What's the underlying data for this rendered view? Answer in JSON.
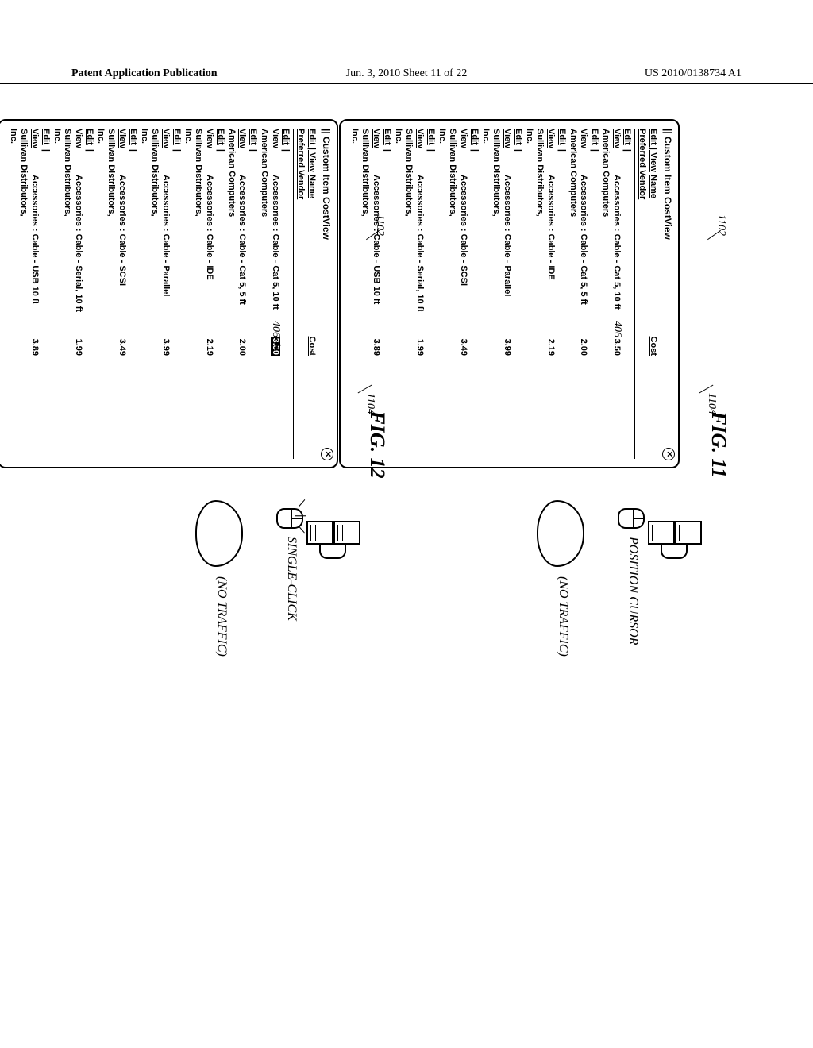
{
  "header": {
    "left": "Patent Application Publication",
    "mid": "Jun. 3, 2010  Sheet 11 of 22",
    "right": "US 2010/0138734 A1"
  },
  "figures": [
    {
      "id": "fig11",
      "number": "FIG. 11",
      "ref_left": "1102",
      "ref_right": "1104",
      "ref_406": "406",
      "panel_title": "|| Custom Item CostView",
      "columns": {
        "actions": "Edit | View",
        "name": "Name",
        "cost": "Cost",
        "vendor": "Preferred Vendor"
      },
      "action_labels": {
        "edit": "Edit",
        "view": "View"
      },
      "rows": [
        {
          "name": "Accessories : Cable - Cat 5, 10 ft",
          "cost": "3.50",
          "vendor": "American Computers"
        },
        {
          "name": "Accessories : Cable - Cat 5, 5 ft",
          "cost": "2.00",
          "vendor": "American Computers"
        },
        {
          "name": "Accessories : Cable - IDE",
          "cost": "2.19",
          "vendor": "Sullivan Distributors, Inc."
        },
        {
          "name": "Accessories : Cable - Parallel",
          "cost": "3.99",
          "vendor": "Sullivan Distributors, Inc."
        },
        {
          "name": "Accessories : Cable - SCSI",
          "cost": "3.49",
          "vendor": "Sullivan Distributors, Inc."
        },
        {
          "name": "Accessories : Cable - Serial, 10 ft",
          "cost": "1.99",
          "vendor": "Sullivan Distributors, Inc."
        },
        {
          "name": "Accessories : Cable - USB 10 ft",
          "cost": "3.89",
          "vendor": "Sullivan Distributors, Inc."
        }
      ],
      "action": "POSITION CURSOR",
      "traffic": "(NO TRAFFIC)",
      "highlight_first_cost": false,
      "show_click_rays": false,
      "show_cursor_arrow": false
    },
    {
      "id": "fig12",
      "number": "FIG. 12",
      "ref_left": "1102",
      "ref_right": "1104",
      "ref_406": "406",
      "panel_title": "|| Custom Item CostView",
      "columns": {
        "actions": "Edit | View",
        "name": "Name",
        "cost": "Cost",
        "vendor": "Preferred Vendor"
      },
      "action_labels": {
        "edit": "Edit",
        "view": "View"
      },
      "rows": [
        {
          "name": "Accessories : Cable - Cat 5, 10 ft",
          "cost": "3.50",
          "vendor": "American Computers"
        },
        {
          "name": "Accessories : Cable - Cat 5, 5 ft",
          "cost": "2.00",
          "vendor": "American Computers"
        },
        {
          "name": "Accessories : Cable - IDE",
          "cost": "2.19",
          "vendor": "Sullivan Distributors, Inc."
        },
        {
          "name": "Accessories : Cable - Parallel",
          "cost": "3.99",
          "vendor": "Sullivan Distributors, Inc."
        },
        {
          "name": "Accessories : Cable - SCSI",
          "cost": "3.49",
          "vendor": "Sullivan Distributors, Inc."
        },
        {
          "name": "Accessories : Cable - Serial, 10 ft",
          "cost": "1.99",
          "vendor": "Sullivan Distributors, Inc."
        },
        {
          "name": "Accessories : Cable - USB 10 ft",
          "cost": "3.89",
          "vendor": "Sullivan Distributors, Inc."
        }
      ],
      "action": "SINGLE-CLICK",
      "traffic": "(NO TRAFFIC)",
      "highlight_first_cost": true,
      "show_click_rays": true,
      "show_cursor_arrow": true
    }
  ]
}
